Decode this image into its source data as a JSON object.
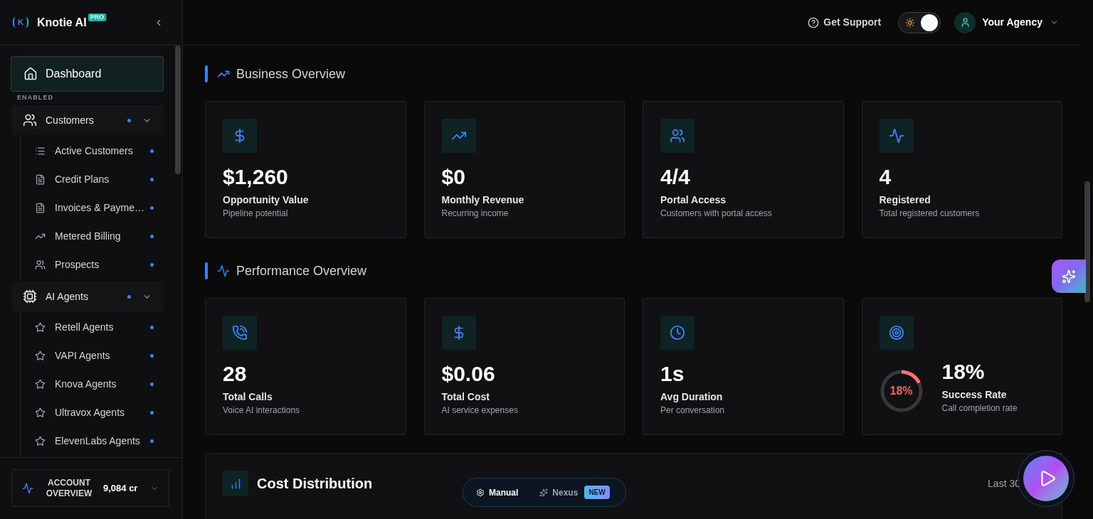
{
  "sidebar": {
    "brand": {
      "logo_mark": "K",
      "name": "Knotie AI",
      "badge": "PRO"
    },
    "nav": [
      {
        "label": "Dashboard",
        "selected": true
      }
    ],
    "section_label": "ENABLED",
    "groups": [
      {
        "label": "Customers",
        "status_dot": true,
        "expanded": true,
        "selected": false,
        "children": [
          {
            "label": "Active Customers",
            "status_dot": true,
            "selected": false
          },
          {
            "label": "Credit Plans",
            "status_dot": true,
            "selected": false
          },
          {
            "label": "Invoices & Payme…",
            "status_dot": true,
            "selected": false
          },
          {
            "label": "Metered Billing",
            "status_dot": true,
            "selected": false
          },
          {
            "label": "Prospects",
            "status_dot": true,
            "selected": false
          }
        ]
      },
      {
        "label": "AI Agents",
        "status_dot": true,
        "expanded": true,
        "selected": false,
        "children": [
          {
            "label": "Retell Agents",
            "status_dot": true,
            "selected": false
          },
          {
            "label": "VAPI Agents",
            "status_dot": true,
            "selected": false
          },
          {
            "label": "Knova Agents",
            "status_dot": true,
            "selected": false
          },
          {
            "label": "Ultravox Agents",
            "status_dot": true,
            "selected": false
          },
          {
            "label": "ElevenLabs Agents",
            "status_dot": true,
            "selected": false
          }
        ]
      }
    ],
    "account": {
      "label": "ACCOUNT OVERVIEW",
      "credits": "9,084 cr"
    }
  },
  "header": {
    "support": "Get Support",
    "theme_toggle": {
      "on": true
    },
    "account": {
      "name": "Your Agency"
    }
  },
  "sections": [
    {
      "title": "Business Overview",
      "cards": [
        {
          "kind": "stat",
          "value": "$1,260",
          "label": "Opportunity Value",
          "caption": "Pipeline potential"
        },
        {
          "kind": "stat",
          "value": "$0",
          "label": "Monthly Revenue",
          "caption": "Recurring income"
        },
        {
          "kind": "stat",
          "value": "4/4",
          "label": "Portal Access",
          "caption": "Customers with portal access"
        },
        {
          "kind": "stat",
          "value": "4",
          "label": "Registered",
          "caption": "Total registered customers"
        }
      ]
    },
    {
      "title": "Performance Overview",
      "cards": [
        {
          "kind": "stat",
          "value": "28",
          "label": "Total Calls",
          "caption": "Voice AI interactions"
        },
        {
          "kind": "stat",
          "value": "$0.06",
          "label": "Total Cost",
          "caption": "AI service expenses"
        },
        {
          "kind": "stat",
          "value": "1s",
          "label": "Avg Duration",
          "caption": "Per conversation"
        },
        {
          "kind": "gauge",
          "value": "18%",
          "gauge": {
            "level": 0.18,
            "reading": "18%"
          },
          "label": "Success Rate",
          "caption": "Call completion rate"
        }
      ]
    }
  ],
  "cost_distribution": {
    "title": "Cost Distribution",
    "range": "Last 30"
  },
  "mode_switch": [
    {
      "label": "Manual",
      "selected": true
    },
    {
      "label": "Nexus",
      "selected": false,
      "badge": "NEW"
    }
  ]
}
